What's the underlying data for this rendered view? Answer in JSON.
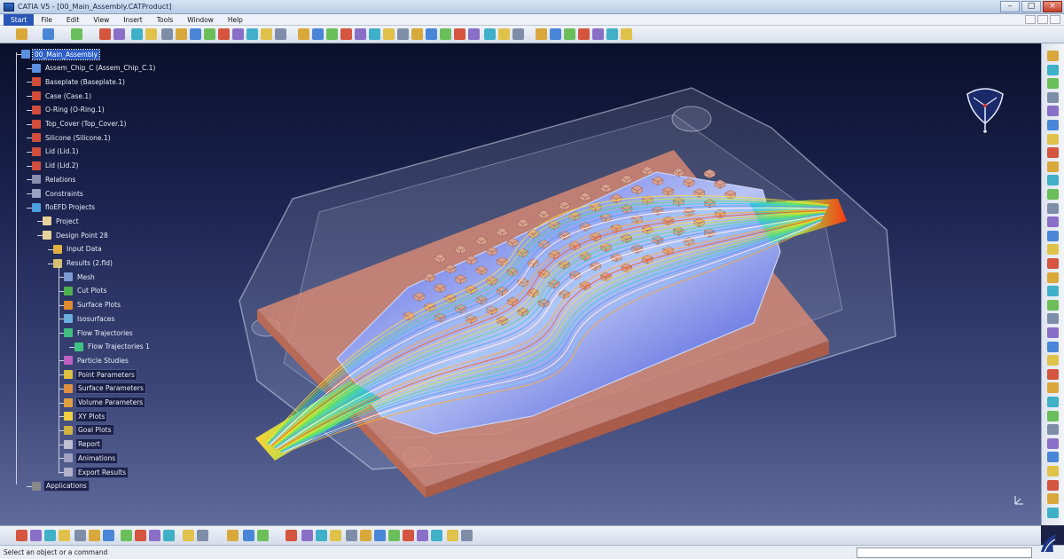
{
  "window": {
    "title": "CATIA V5 - [00_Main_Assembly.CATProduct]",
    "controls": {
      "minimize": "–",
      "maximize": "□",
      "close": "×"
    }
  },
  "menubar": {
    "items": [
      "Start",
      "File",
      "Edit",
      "View",
      "Insert",
      "Tools",
      "Window",
      "Help"
    ],
    "active": "Start"
  },
  "tree": {
    "items": [
      {
        "label": "00_Main_Assembly",
        "icon": "product-icon",
        "selected": true
      },
      {
        "label": "Assem_Chip_C (Assem_Chip_C.1)",
        "icon": "product-icon"
      },
      {
        "label": "Baseplate (Baseplate.1)",
        "icon": "part-icon"
      },
      {
        "label": "Case (Case.1)",
        "icon": "part-icon"
      },
      {
        "label": "O-Ring (O-Ring.1)",
        "icon": "part-icon"
      },
      {
        "label": "Top_Cover (Top_Cover.1)",
        "icon": "part-icon"
      },
      {
        "label": "Silicone (Silicone.1)",
        "icon": "part-icon"
      },
      {
        "label": "Lid (Lid.1)",
        "icon": "part-icon"
      },
      {
        "label": "Lid (Lid.2)",
        "icon": "part-icon"
      },
      {
        "label": "Relations",
        "icon": "relations-icon"
      },
      {
        "label": "Constraints",
        "icon": "constraints-icon"
      },
      {
        "label": "floEFD Projects",
        "icon": "project-folder-icon"
      },
      {
        "label": "Project",
        "icon": "folder-icon"
      },
      {
        "label": "Design Point 28",
        "icon": "folder-icon"
      },
      {
        "label": "Input Data",
        "icon": "input-data-icon"
      },
      {
        "label": "Results (2.fld)",
        "icon": "results-icon"
      },
      {
        "label": "Mesh",
        "icon": "mesh-icon"
      },
      {
        "label": "Cut Plots",
        "icon": "cut-plot-icon"
      },
      {
        "label": "Surface Plots",
        "icon": "surface-plot-icon"
      },
      {
        "label": "Isosurfaces",
        "icon": "isosurface-icon"
      },
      {
        "label": "Flow Trajectories",
        "icon": "flow-trajectory-icon"
      },
      {
        "label": "Flow Trajectories 1",
        "icon": "flow-trajectory-icon"
      },
      {
        "label": "Particle Studies",
        "icon": "particle-study-icon"
      },
      {
        "label": "Point Parameters",
        "icon": "point-parameter-icon"
      },
      {
        "label": "Surface Parameters",
        "icon": "surface-parameter-icon"
      },
      {
        "label": "Volume Parameters",
        "icon": "volume-parameter-icon"
      },
      {
        "label": "XY Plots",
        "icon": "xy-plot-icon"
      },
      {
        "label": "Goal Plots",
        "icon": "goal-plot-icon"
      },
      {
        "label": "Report",
        "icon": "report-icon"
      },
      {
        "label": "Animations",
        "icon": "animation-icon"
      },
      {
        "label": "Export Results",
        "icon": "export-icon"
      },
      {
        "label": "Applications",
        "icon": "applications-icon"
      }
    ]
  },
  "status": {
    "message": "Select an object or a command"
  },
  "colors": {
    "selection": "#2d5fc9",
    "viewport_top": "#0a0f2a",
    "viewport_bottom": "#5f6b9a",
    "baseplate": "#d6826b",
    "flow_hot": "#ff2a00",
    "flow_cold": "#1a2cff"
  }
}
